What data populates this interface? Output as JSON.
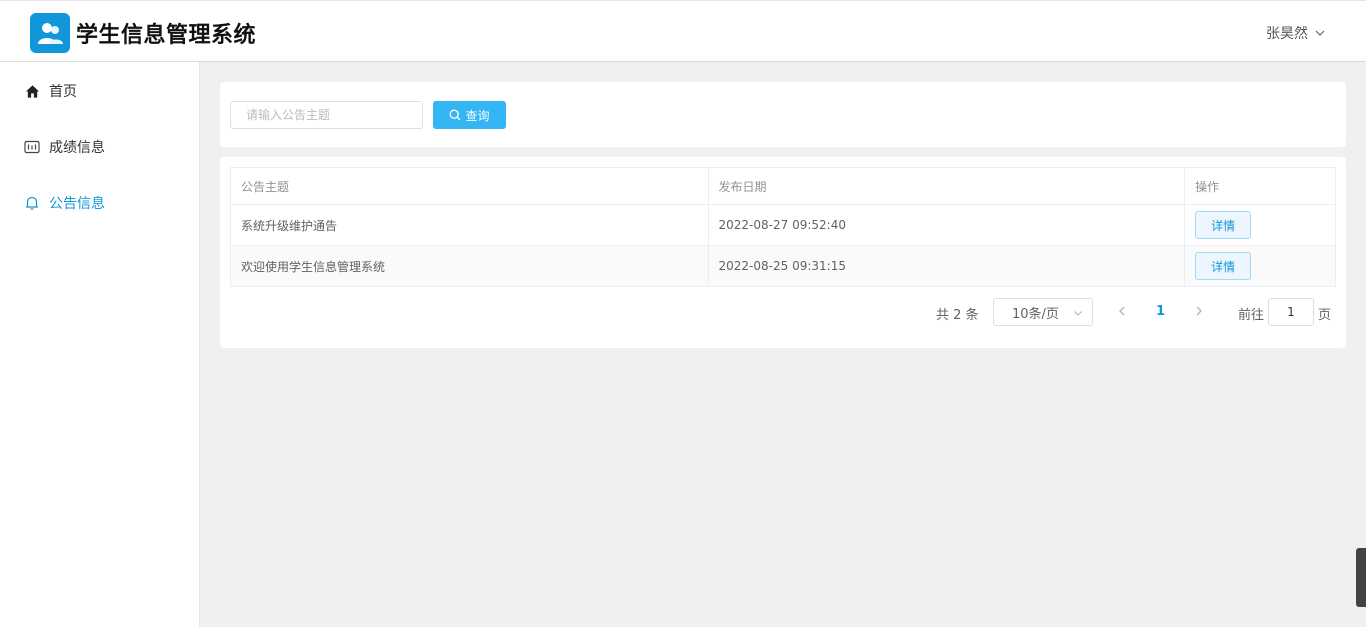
{
  "header": {
    "app_title": "学生信息管理系统",
    "user_name": "张昊然"
  },
  "sidebar": {
    "items": [
      {
        "label": "首页",
        "icon": "home-icon"
      },
      {
        "label": "成绩信息",
        "icon": "score-icon"
      },
      {
        "label": "公告信息",
        "icon": "bell-icon",
        "active": true
      }
    ]
  },
  "search": {
    "placeholder": "请输入公告主题",
    "button_label": "查询"
  },
  "table": {
    "columns": [
      "公告主题",
      "发布日期",
      "操作"
    ],
    "rows": [
      {
        "title": "系统升级维护通告",
        "date": "2022-08-27 09:52:40",
        "action": "详情"
      },
      {
        "title": "欢迎使用学生信息管理系统",
        "date": "2022-08-25 09:31:15",
        "action": "详情"
      }
    ]
  },
  "pagination": {
    "total_label": "共 2 条",
    "page_size": "10条/页",
    "current_page": "1",
    "goto_label": "前往",
    "goto_value": "1",
    "page_unit": "页"
  },
  "colors": {
    "accent": "#1296db",
    "search_button": "#35b6f4"
  }
}
